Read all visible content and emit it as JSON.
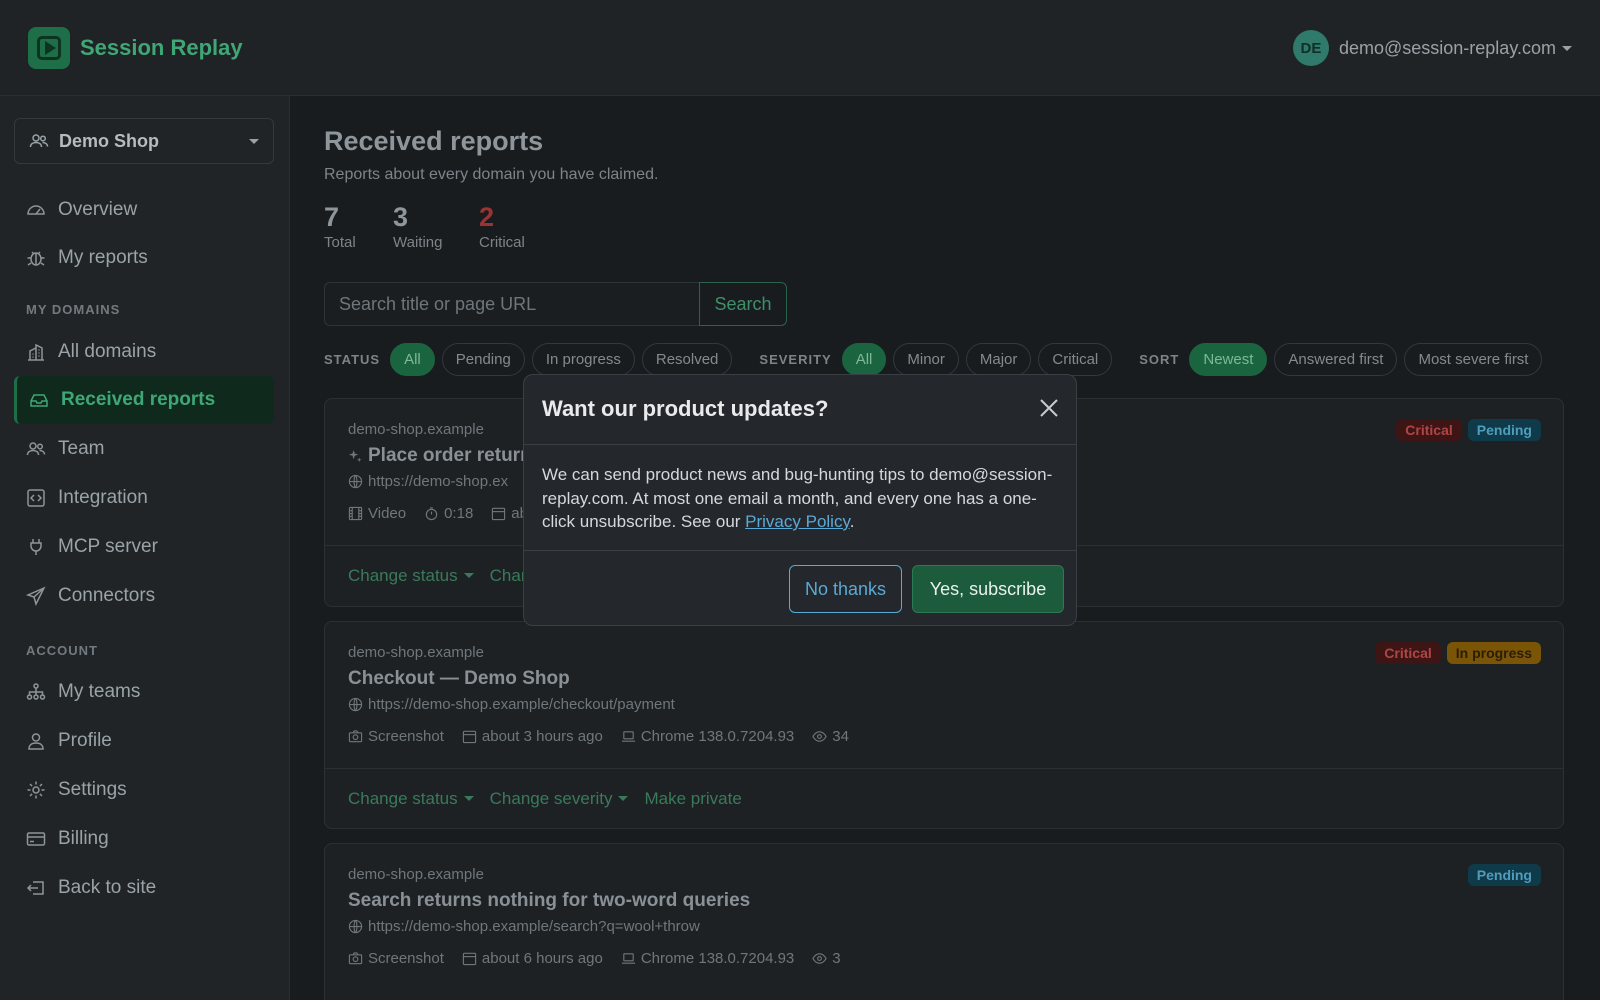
{
  "app": {
    "name": "Session Replay",
    "user_initials": "DE",
    "user_email": "demo@session-replay.com"
  },
  "sidebar": {
    "org": "Demo Shop",
    "items_top": [
      {
        "label": "Overview",
        "icon": "gauge-icon"
      },
      {
        "label": "My reports",
        "icon": "bug-icon"
      }
    ],
    "section_domains": "MY DOMAINS",
    "items_domains": [
      {
        "label": "All domains",
        "icon": "buildings-icon"
      },
      {
        "label": "Received reports",
        "icon": "inbox-icon",
        "active": true
      },
      {
        "label": "Team",
        "icon": "people-icon"
      },
      {
        "label": "Integration",
        "icon": "code-icon"
      },
      {
        "label": "MCP server",
        "icon": "plug-icon"
      },
      {
        "label": "Connectors",
        "icon": "send-icon"
      }
    ],
    "section_account": "ACCOUNT",
    "items_account": [
      {
        "label": "My teams",
        "icon": "diagram-icon"
      },
      {
        "label": "Profile",
        "icon": "person-icon"
      },
      {
        "label": "Settings",
        "icon": "gear-icon"
      },
      {
        "label": "Billing",
        "icon": "credit-card-icon"
      },
      {
        "label": "Back to site",
        "icon": "box-arrow-left-icon"
      }
    ]
  },
  "main": {
    "title": "Received reports",
    "subtitle": "Reports about every domain you have claimed.",
    "stats": [
      {
        "value": "7",
        "label": "Total"
      },
      {
        "value": "3",
        "label": "Waiting"
      },
      {
        "value": "2",
        "label": "Critical"
      }
    ],
    "search": {
      "placeholder": "Search title or page URL",
      "button": "Search"
    },
    "filters": {
      "status_label": "STATUS",
      "status": [
        "All",
        "Pending",
        "In progress",
        "Resolved"
      ],
      "severity_label": "SEVERITY",
      "severity": [
        "All",
        "Minor",
        "Major",
        "Critical"
      ],
      "sort_label": "SORT",
      "sort": [
        "Newest",
        "Answered first",
        "Most severe first"
      ]
    },
    "actions": {
      "change_status": "Change status",
      "change_severity": "Change severity",
      "make_private": "Make private",
      "change_severity_partial": "Chan"
    },
    "reports": [
      {
        "domain": "demo-shop.example",
        "title": "Place order returns",
        "url": "https://demo-shop.ex",
        "type": "Video",
        "duration": "0:18",
        "date": "ab",
        "badges": [
          "Critical",
          "Pending"
        ]
      },
      {
        "domain": "demo-shop.example",
        "title": "Checkout — Demo Shop",
        "url": "https://demo-shop.example/checkout/payment",
        "type": "Screenshot",
        "date": "about 3 hours ago",
        "browser": "Chrome 138.0.7204.93",
        "views": "34",
        "badges": [
          "Critical",
          "In progress"
        ]
      },
      {
        "domain": "demo-shop.example",
        "title": "Search returns nothing for two-word queries",
        "url": "https://demo-shop.example/search?q=wool+throw",
        "type": "Screenshot",
        "date": "about 6 hours ago",
        "browser": "Chrome 138.0.7204.93",
        "views": "3",
        "badges": [
          "Pending"
        ]
      }
    ]
  },
  "modal": {
    "title": "Want our product updates?",
    "body_prefix": "We can send product news and bug-hunting tips to demo@session-replay.com. At most one email a month, and every one has a one-click unsubscribe. See our ",
    "body_link": "Privacy Policy",
    "body_suffix": ".",
    "no_button": "No thanks",
    "yes_button": "Yes, subscribe"
  }
}
